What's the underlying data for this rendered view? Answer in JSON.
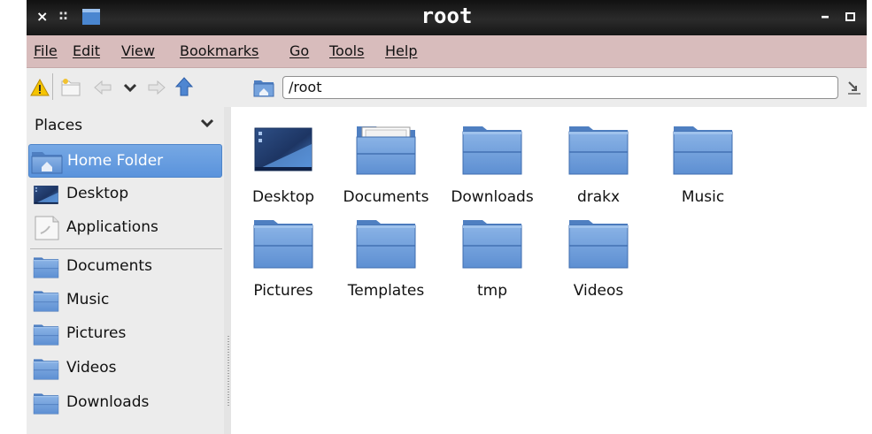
{
  "window": {
    "title": "root",
    "close_glyph": "×",
    "grip_glyph": "::",
    "minimize_glyph": "–",
    "icons": [
      "close-icon",
      "grip-icon",
      "window-menu-icon",
      "minimize-icon",
      "maximize-icon"
    ]
  },
  "menubar": {
    "items": [
      "File",
      "Edit",
      "View",
      "Bookmarks",
      "Go",
      "Tools",
      "Help"
    ]
  },
  "toolbar": {
    "location_value": "/root",
    "icons": [
      "warning-icon",
      "new-folder-icon",
      "back-icon",
      "history-dropdown-icon",
      "forward-icon",
      "up-icon",
      "home-location-icon",
      "clear-location-icon"
    ]
  },
  "sidebar": {
    "header": "Places",
    "items": [
      {
        "label": "Home Folder",
        "icon": "home-folder-icon",
        "selected": true
      },
      {
        "label": "Desktop",
        "icon": "desktop-icon"
      },
      {
        "label": "Applications",
        "icon": "applications-icon"
      },
      {
        "label": "Documents",
        "icon": "folder-icon"
      },
      {
        "label": "Music",
        "icon": "folder-icon"
      },
      {
        "label": "Pictures",
        "icon": "folder-icon"
      },
      {
        "label": "Videos",
        "icon": "folder-icon"
      },
      {
        "label": "Downloads",
        "icon": "folder-icon"
      }
    ]
  },
  "files": [
    {
      "label": "Desktop",
      "icon": "desktop-icon"
    },
    {
      "label": "Documents",
      "icon": "documents-folder-icon"
    },
    {
      "label": "Downloads",
      "icon": "folder-icon"
    },
    {
      "label": "drakx",
      "icon": "folder-icon"
    },
    {
      "label": "Music",
      "icon": "folder-icon"
    },
    {
      "label": "Pictures",
      "icon": "folder-icon"
    },
    {
      "label": "Templates",
      "icon": "folder-icon"
    },
    {
      "label": "tmp",
      "icon": "folder-icon"
    },
    {
      "label": "Videos",
      "icon": "folder-icon"
    }
  ],
  "colors": {
    "titlebar": "#1c1c1c",
    "menubar": "#d8bcbc",
    "selection": "#6aa0e0",
    "folder_blue": "#6d9cd8",
    "content_bg": "#ffffff"
  }
}
